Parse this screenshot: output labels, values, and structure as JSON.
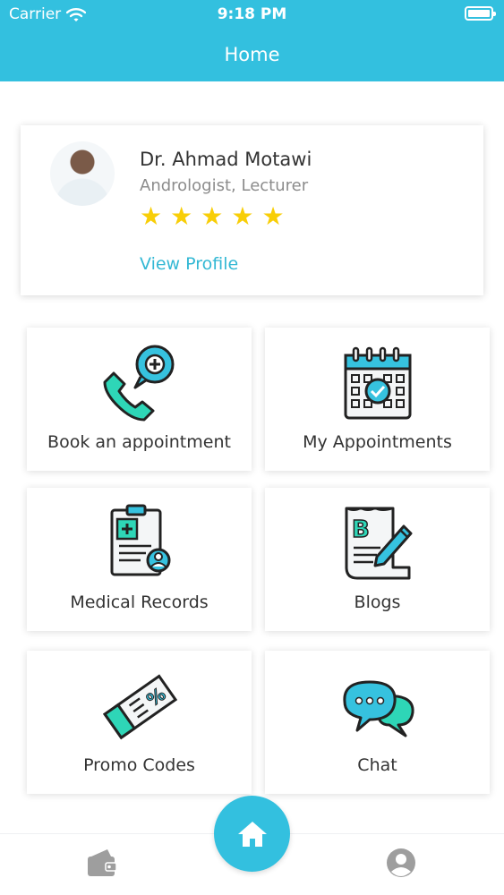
{
  "status_bar": {
    "carrier": "Carrier",
    "time": "9:18 PM"
  },
  "header": {
    "title": "Home"
  },
  "doctor": {
    "name": "Dr. Ahmad Motawi",
    "specialty": "Andrologist, Lecturer",
    "rating": 5,
    "view_profile_label": "View Profile"
  },
  "tiles": [
    {
      "label": "Book an appointment",
      "icon": "phone-plus-icon"
    },
    {
      "label": "My Appointments",
      "icon": "calendar-check-icon"
    },
    {
      "label": "Medical Records",
      "icon": "clipboard-record-icon"
    },
    {
      "label": "Blogs",
      "icon": "blog-pen-icon"
    },
    {
      "label": "Promo Codes",
      "icon": "coupon-percent-icon"
    },
    {
      "label": "Chat",
      "icon": "chat-bubbles-icon"
    }
  ],
  "bottom_nav": {
    "left_icon": "wallet-icon",
    "center_icon": "home-icon",
    "right_icon": "profile-icon"
  },
  "colors": {
    "primary": "#33c0df",
    "accent_green": "#2ed6b7",
    "star": "#f8ce07",
    "link": "#33b8d4"
  }
}
